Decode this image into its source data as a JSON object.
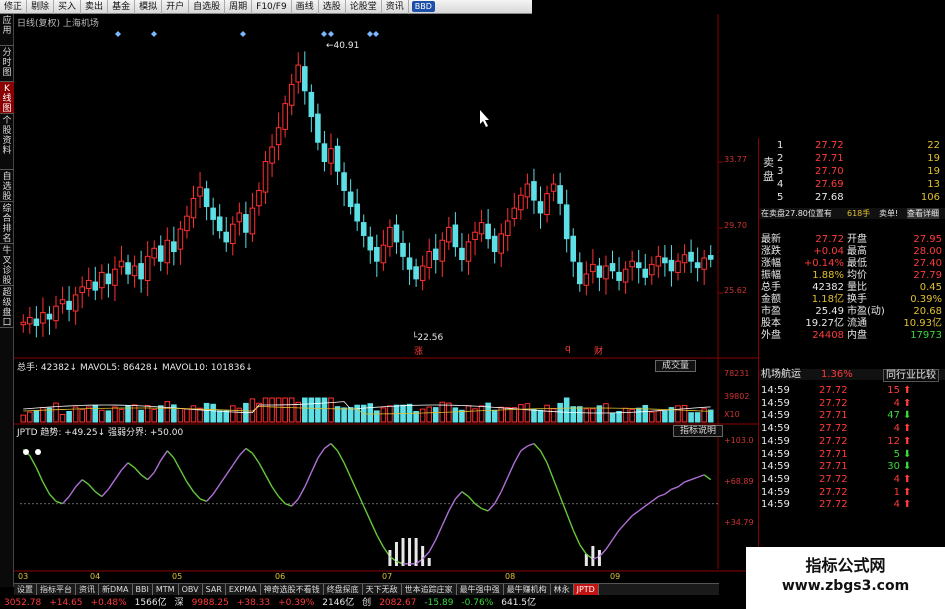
{
  "toolbar": {
    "items": [
      "修正",
      "剔除",
      "买入",
      "卖出",
      "基金",
      "模拟",
      "开户",
      "自选股",
      "周期",
      "F10/F9",
      "画线",
      "选股",
      "论股堂",
      "资讯"
    ],
    "badge": "BBD"
  },
  "sidebar": {
    "items": [
      "应用",
      "分时图",
      "K线图",
      "个股资料",
      "自选股",
      "综合排名",
      "牛叉诊股",
      "超级盘口"
    ]
  },
  "chart": {
    "title": "日线(复权) 上海机场",
    "price_labels": [
      "33.77",
      "29.70",
      "25.62"
    ],
    "high_label": "40.91",
    "low_label": "22.56",
    "markers": [
      "涨",
      "q",
      "财"
    ],
    "volume_legend": {
      "total": "总手: 42382",
      "mavol5": "MAVOL5: 86428",
      "mavol10": "MAVOL10: 101836"
    },
    "volume_tab": "成交量",
    "volume_labels": [
      "78231",
      "39802",
      "X10"
    ],
    "indicator_legend": {
      "name": "JPTD",
      "trend": "趋势: +49.25",
      "divide": "强弱分界: +50.00"
    },
    "indicator_tab": "指标说明",
    "indicator_labels": [
      "+103.0",
      "+68.89",
      "+34.79"
    ],
    "x_labels": [
      "03",
      "04",
      "05",
      "06",
      "07",
      "08",
      "09"
    ],
    "colors": {
      "up": "#ff3030",
      "down": "#5ce0e6",
      "axis": "#8a0000",
      "ind_up": "#b070d8",
      "ind_down": "#66c83a"
    }
  },
  "chart_data": {
    "type": "candlestick",
    "title": "日线(复权) 上海机场",
    "x_ticks": [
      "03",
      "04",
      "05",
      "06",
      "07",
      "08",
      "09"
    ],
    "y_ticks": [
      25.62,
      29.7,
      33.77
    ],
    "high": 40.91,
    "low": 22.56,
    "closes": [
      23.8,
      24.1,
      23.6,
      24.4,
      24.0,
      24.8,
      25.2,
      24.6,
      25.5,
      26.0,
      26.4,
      25.8,
      26.9,
      26.2,
      27.1,
      27.6,
      26.8,
      27.3,
      26.5,
      27.9,
      28.4,
      27.6,
      28.9,
      28.2,
      29.6,
      30.4,
      31.5,
      32.2,
      31.0,
      30.2,
      29.5,
      28.8,
      29.9,
      30.6,
      29.4,
      30.9,
      32.0,
      33.8,
      34.7,
      35.9,
      37.4,
      38.6,
      39.8,
      38.2,
      36.6,
      35.0,
      33.8,
      34.6,
      33.2,
      32.0,
      31.0,
      30.1,
      29.2,
      28.3,
      27.6,
      28.6,
      29.7,
      28.8,
      27.9,
      27.1,
      26.5,
      27.3,
      28.2,
      27.7,
      28.9,
      29.7,
      28.5,
      27.7,
      28.8,
      29.4,
      30.0,
      29.0,
      28.2,
      29.3,
      30.1,
      30.9,
      31.7,
      32.4,
      31.4,
      30.6,
      31.8,
      32.4,
      31.2,
      29.0,
      27.6,
      26.2,
      26.8,
      27.4,
      26.6,
      27.3,
      27.0,
      26.4,
      27.1,
      27.6,
      27.2,
      26.6,
      27.4,
      27.9,
      27.5,
      27.0,
      27.6,
      28.0,
      27.6,
      27.2,
      27.8,
      27.72
    ],
    "volume_ticks": [
      78231,
      39802
    ],
    "volume": {
      "total": 42382,
      "mavol5": 86428,
      "mavol10": 101836
    },
    "indicator": {
      "name": "JPTD",
      "trend": 49.25,
      "divide": 50.0,
      "y_ticks": [
        103.0,
        68.89,
        34.79
      ],
      "values": [
        95,
        90,
        80,
        68,
        58,
        52,
        50,
        56,
        64,
        70,
        66,
        60,
        56,
        62,
        70,
        78,
        84,
        80,
        74,
        70,
        76,
        86,
        94,
        88,
        78,
        68,
        60,
        54,
        52,
        58,
        66,
        74,
        82,
        90,
        96,
        92,
        84,
        74,
        64,
        56,
        50,
        48,
        54,
        64,
        76,
        88,
        96,
        100,
        94,
        84,
        72,
        60,
        48,
        36,
        24,
        14,
        6,
        2,
        0,
        0,
        0,
        4,
        10,
        20,
        32,
        44,
        54,
        60,
        56,
        50,
        46,
        44,
        50,
        60,
        72,
        84,
        94,
        98,
        100,
        94,
        84,
        70,
        56,
        42,
        28,
        16,
        8,
        4,
        6,
        12,
        20,
        28,
        34,
        40,
        44,
        48,
        52,
        56,
        58,
        62,
        64,
        68,
        70,
        72,
        74,
        70
      ]
    }
  },
  "orderbook": {
    "asks": [
      {
        "n": "5",
        "p": "27.68",
        "v": "106"
      },
      {
        "n": "4",
        "p": "27.69",
        "v": "13"
      },
      {
        "n": "3",
        "p": "27.70",
        "v": "19"
      },
      {
        "n": "2",
        "p": "27.71",
        "v": "19"
      },
      {
        "n": "1",
        "p": "27.72",
        "v": "22"
      }
    ],
    "ask_label": "卖盘",
    "info_bar": {
      "a": "在卖盘27.80位置有",
      "b": "618手",
      "c": "卖单!",
      "d": "查看详细"
    }
  },
  "quote": {
    "rows": [
      {
        "l": "最新",
        "v": "27.72",
        "l2": "开盘",
        "v2": "27.95"
      },
      {
        "l": "涨跌",
        "v": "+0.04",
        "l2": "最高",
        "v2": "28.00"
      },
      {
        "l": "涨幅",
        "v": "+0.14%",
        "l2": "最低",
        "v2": "27.40"
      },
      {
        "l": "振幅",
        "v": "1.88%",
        "l2": "均价",
        "v2": "27.79"
      },
      {
        "l": "总手",
        "v": "42382",
        "l2": "量比",
        "v2": "0.45"
      },
      {
        "l": "金额",
        "v": "1.18亿",
        "l2": "换手",
        "v2": "0.39%"
      },
      {
        "l": "市盈",
        "v": "25.49",
        "l2": "市盈(动)",
        "v2": "20.68"
      },
      {
        "l": "股本",
        "v": "19.27亿",
        "l2": "流通",
        "v2": "10.93亿"
      },
      {
        "l": "外盘",
        "v": "24408",
        "l2": "内盘",
        "v2": "17973"
      }
    ]
  },
  "sector": {
    "name": "机场航运",
    "pct": "1.36%",
    "compare": "同行业比较"
  },
  "ticks": [
    {
      "t": "14:59",
      "p": "27.72",
      "v": "15",
      "d": "up"
    },
    {
      "t": "14:59",
      "p": "27.72",
      "v": "4",
      "d": "up"
    },
    {
      "t": "14:59",
      "p": "27.71",
      "v": "47",
      "d": "down"
    },
    {
      "t": "14:59",
      "p": "27.72",
      "v": "4",
      "d": "up"
    },
    {
      "t": "14:59",
      "p": "27.72",
      "v": "12",
      "d": "up"
    },
    {
      "t": "14:59",
      "p": "27.71",
      "v": "5",
      "d": "down"
    },
    {
      "t": "14:59",
      "p": "27.71",
      "v": "30",
      "d": "down"
    },
    {
      "t": "14:59",
      "p": "27.72",
      "v": "4",
      "d": "up"
    },
    {
      "t": "14:59",
      "p": "27.72",
      "v": "1",
      "d": "up"
    },
    {
      "t": "14:59",
      "p": "27.72",
      "v": "4",
      "d": "up"
    }
  ],
  "bottom_tabs": [
    "设置",
    "指标平台",
    "资讯",
    "新DMA",
    "BBI",
    "MTM",
    "OBV",
    "SAR",
    "EXPMA",
    "神奇选股不看钱",
    "终盘探底",
    "天下无敌",
    "世本追踪庄家",
    "最牛强中强",
    "最牛赚机构",
    "林永",
    "JPTD"
  ],
  "status": [
    "3052.78",
    "+14.65",
    "+0.48%",
    "1566亿",
    "深",
    "9988.25",
    "+38.33",
    "+0.39%",
    "2146亿",
    "创",
    "2082.67",
    "-15.89",
    "-0.76%",
    "641.5亿"
  ],
  "watermark": {
    "line1": "指标公式网",
    "line2": "www.zbgs3.com"
  }
}
